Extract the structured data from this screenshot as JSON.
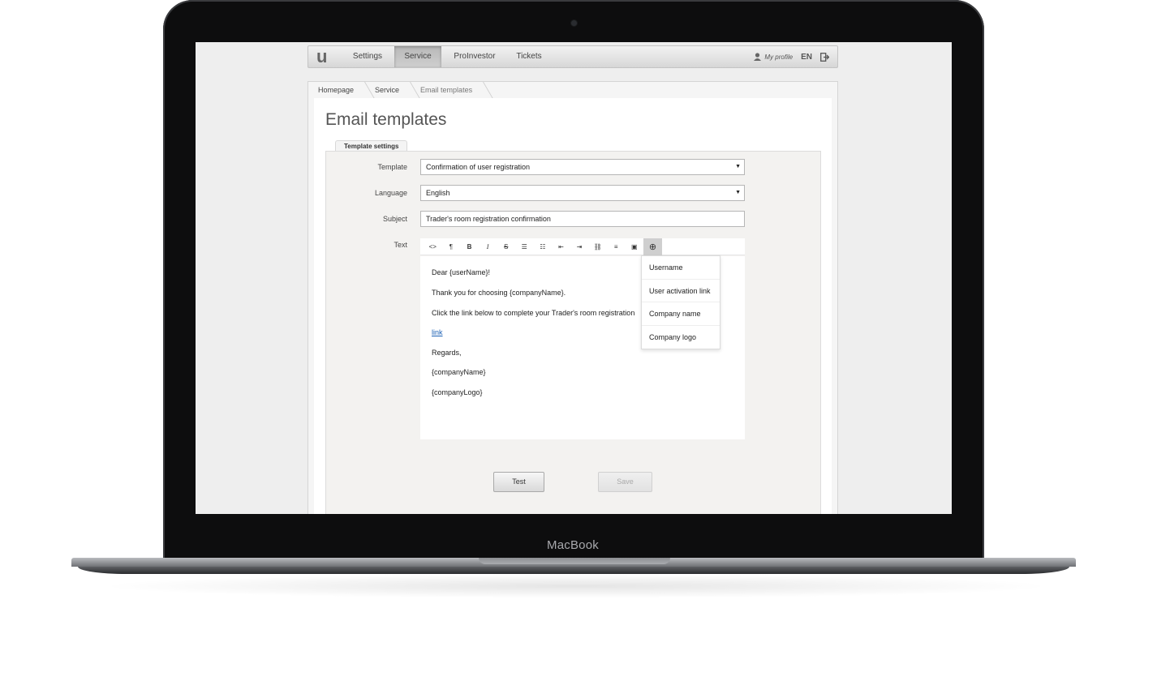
{
  "device": {
    "label": "MacBook"
  },
  "nav": {
    "logo": "u",
    "items": [
      "Settings",
      "Service",
      "ProInvestor",
      "Tickets"
    ],
    "active": "Service",
    "profile": "My profile",
    "lang": "EN"
  },
  "breadcrumbs": [
    "Homepage",
    "Service",
    "Email templates"
  ],
  "page": {
    "title": "Email templates",
    "tab": "Template settings"
  },
  "form": {
    "template_label": "Template",
    "template_value": "Confirmation of user registration",
    "language_label": "Language",
    "language_value": "English",
    "subject_label": "Subject",
    "subject_value": "Trader's room registration confirmation",
    "text_label": "Text"
  },
  "toolbar": {
    "buttons": [
      "html-icon",
      "paragraph-icon",
      "bold-icon",
      "italic-icon",
      "strikethrough-icon",
      "unordered-list-icon",
      "ordered-list-icon",
      "outdent-icon",
      "indent-icon",
      "link-icon",
      "align-icon",
      "image-icon",
      "insert-variable-icon"
    ],
    "glyphs": [
      "<>",
      "¶",
      "B",
      "I",
      "S",
      "☰",
      "☷",
      "⇤",
      "⇥",
      "⛓",
      "≡",
      "▣",
      "⊕"
    ]
  },
  "editor": {
    "lines": [
      "Dear {userName}!",
      "Thank you for choosing {companyName}.",
      "Click the link below to complete your Trader's room registration",
      "link",
      "Regards,",
      "{companyName}",
      "{companyLogo}"
    ]
  },
  "dropdown": {
    "items": [
      "Username",
      "User activation link",
      "Company name",
      "Company logo"
    ]
  },
  "buttons": {
    "test": "Test",
    "save": "Save"
  },
  "colors": {
    "link": "#1a5fb4",
    "active_tab": "#b8b8b8"
  }
}
